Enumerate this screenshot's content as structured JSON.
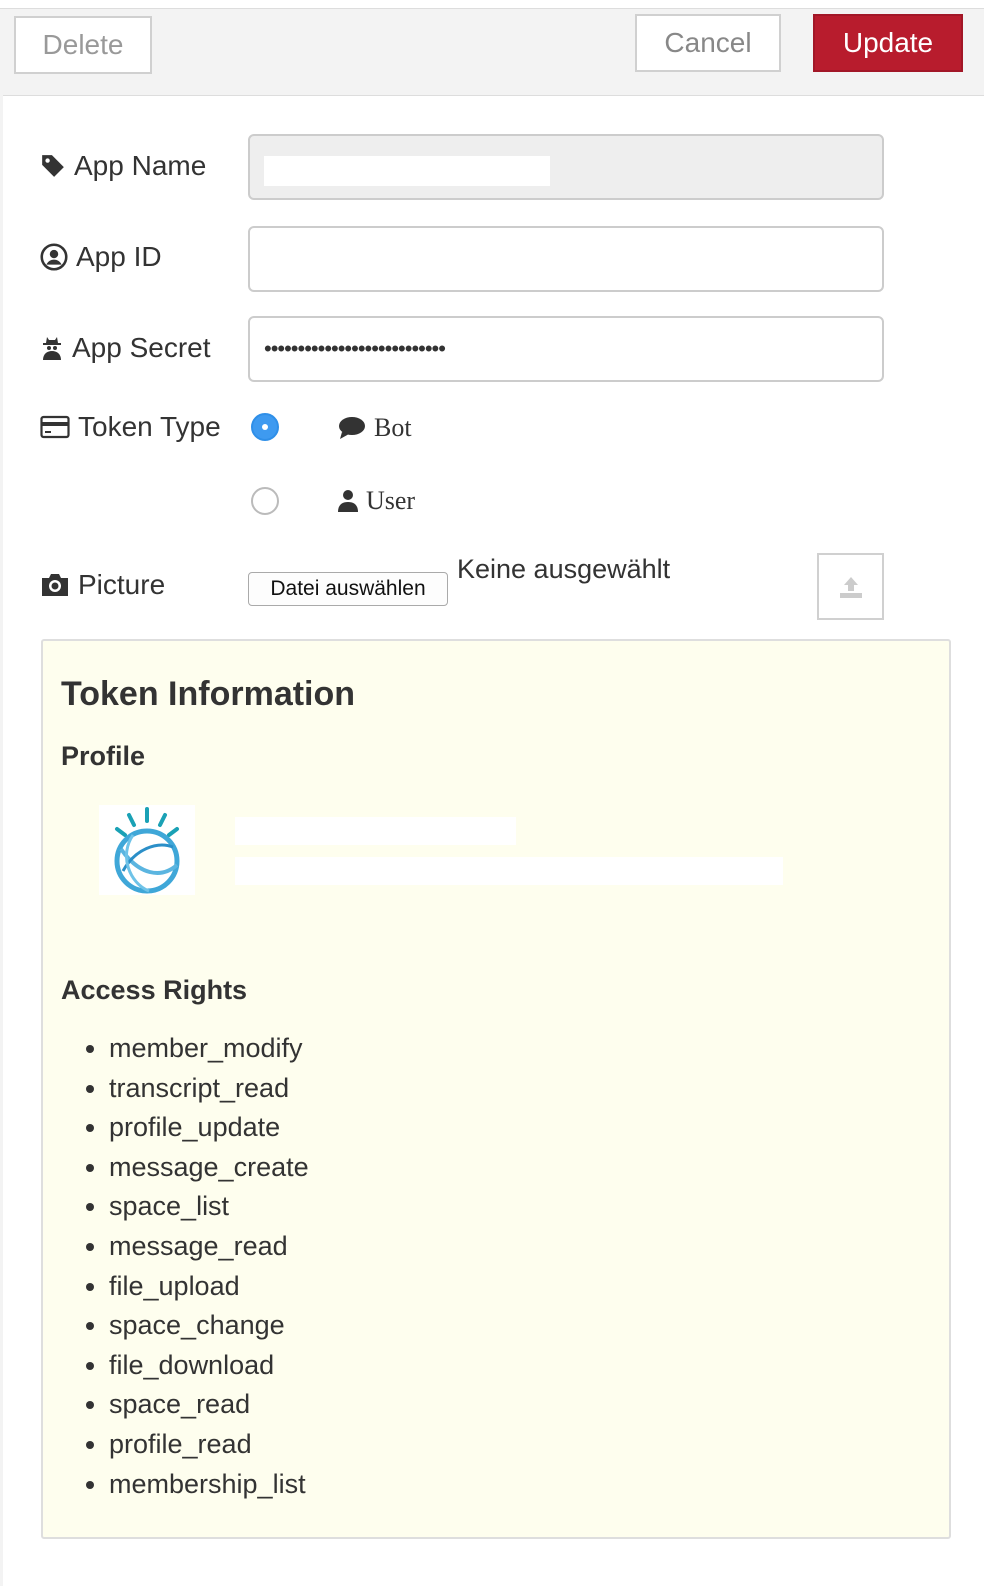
{
  "toolbar": {
    "delete_label": "Delete",
    "cancel_label": "Cancel",
    "update_label": "Update",
    "update_color": "#b81c2d"
  },
  "form": {
    "app_name": {
      "label": "App Name",
      "value": "",
      "icon": "tag-icon"
    },
    "app_id": {
      "label": "App ID",
      "value": "",
      "icon": "user-circle-icon"
    },
    "app_secret": {
      "label": "App Secret",
      "value": "•••••••••••••••••••••••••••",
      "icon": "user-secret-icon"
    },
    "token_type": {
      "label": "Token Type",
      "icon": "credit-card-icon",
      "options": [
        {
          "label": "Bot",
          "icon": "comment-icon",
          "checked": true
        },
        {
          "label": "User",
          "icon": "user-icon",
          "checked": false
        }
      ]
    },
    "picture": {
      "label": "Picture",
      "icon": "camera-icon",
      "choose_label": "Datei auswählen",
      "no_file_text": "Keine ausgewählt",
      "upload_icon": "upload-icon"
    }
  },
  "token_info": {
    "title": "Token Information",
    "profile_heading": "Profile",
    "avatar_icon": "ibm-watson-logo",
    "access_rights_heading": "Access Rights",
    "access_rights": [
      "member_modify",
      "transcript_read",
      "profile_update",
      "message_create",
      "space_list",
      "message_read",
      "file_upload",
      "space_change",
      "file_download",
      "space_read",
      "profile_read",
      "membership_list"
    ]
  }
}
